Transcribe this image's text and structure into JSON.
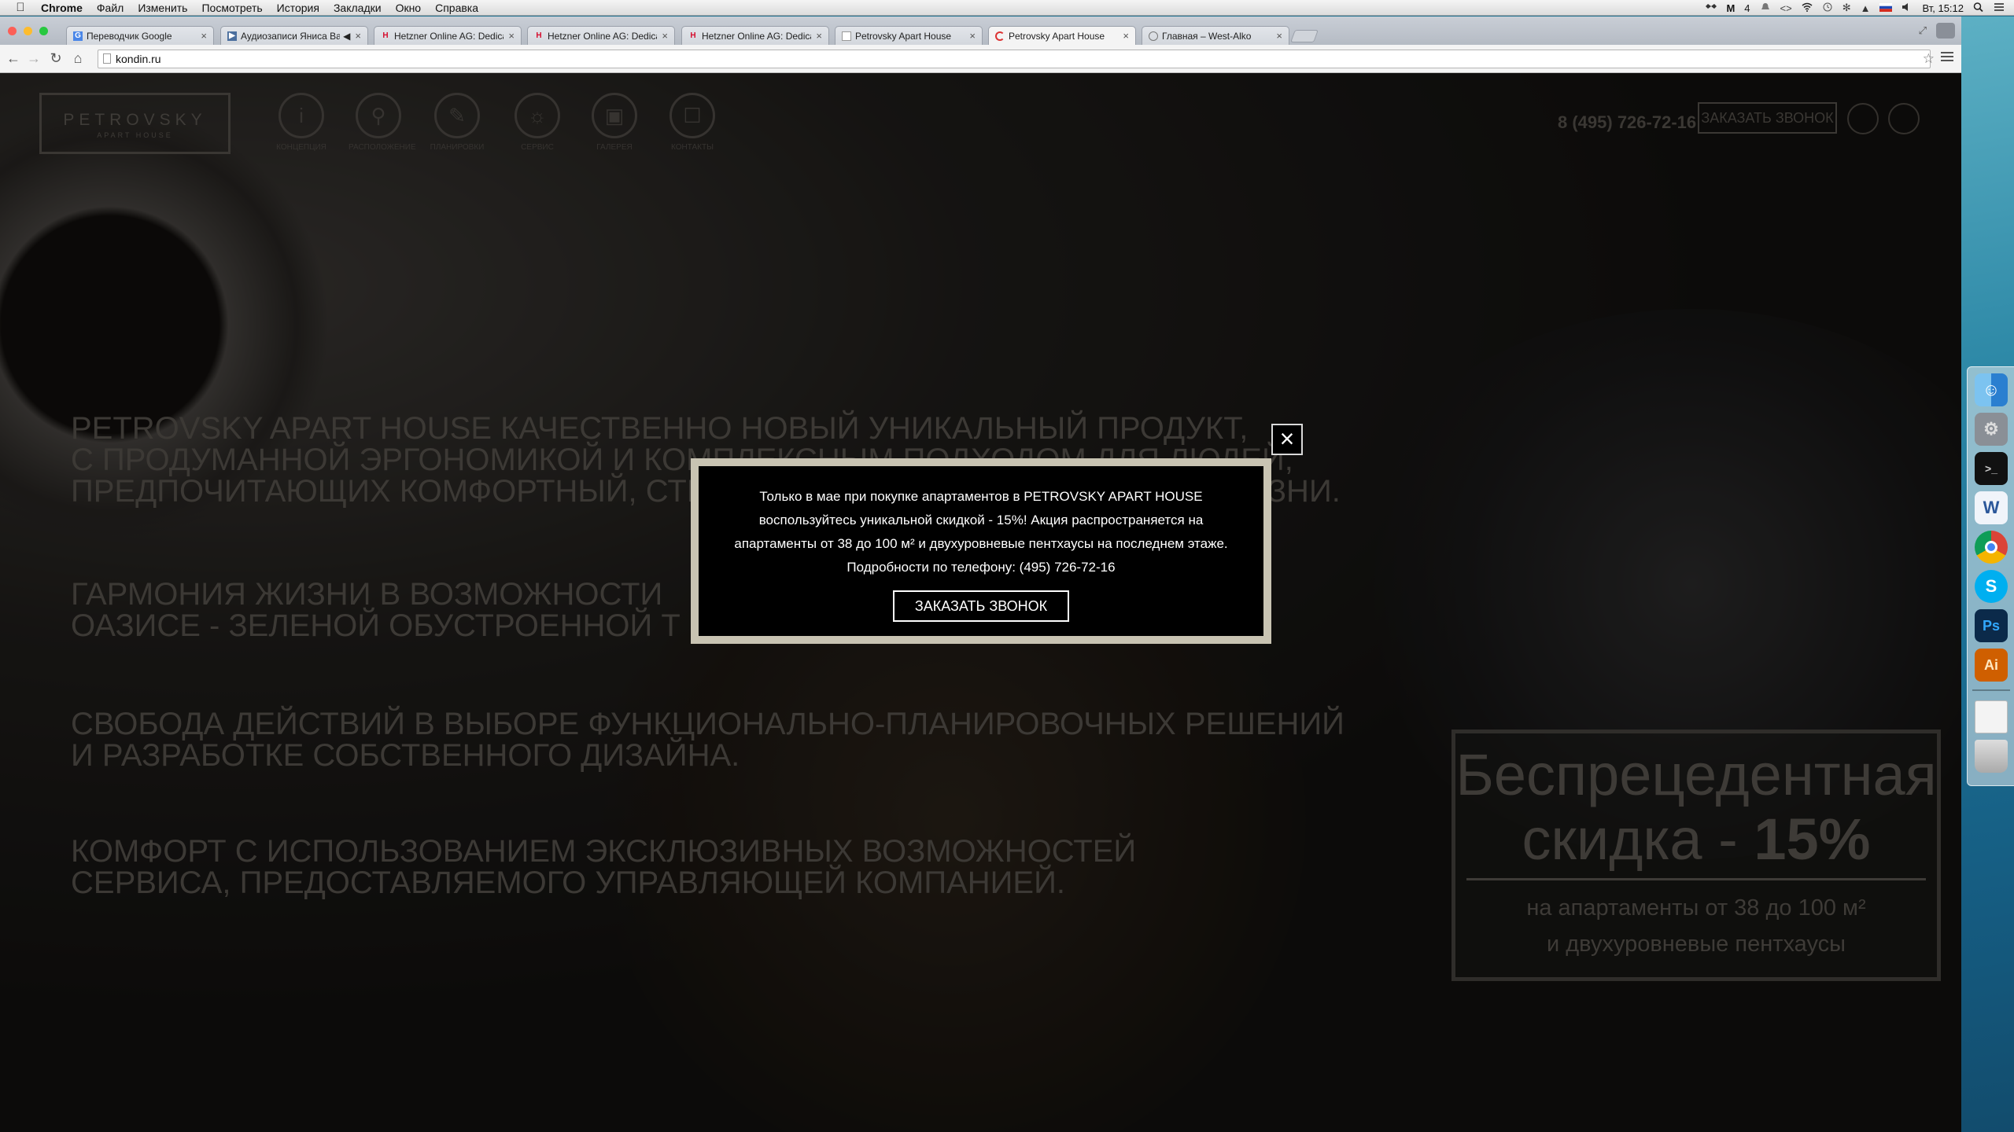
{
  "menubar": {
    "app": "Chrome",
    "items": [
      "Файл",
      "Изменить",
      "Посмотреть",
      "История",
      "Закладки",
      "Окно",
      "Справка"
    ],
    "status": {
      "count": "4",
      "clock": "Вт, 15:12"
    }
  },
  "browser": {
    "tabs": [
      {
        "label": "Переводчик Google"
      },
      {
        "label": "Аудиозаписи Яниса Ва"
      },
      {
        "label": "Hetzner Online AG: Dedica"
      },
      {
        "label": "Hetzner Online AG: Dedica"
      },
      {
        "label": "Hetzner Online AG: Dedica"
      },
      {
        "label": "Petrovsky Apart House"
      },
      {
        "label": "Petrovsky Apart House"
      },
      {
        "label": "Главная – West-Alko"
      }
    ],
    "url": "kondin.ru"
  },
  "site": {
    "logo": {
      "line1": "PETROVSKY",
      "line2": "APART HOUSE"
    },
    "nav": [
      {
        "label": "КОНЦЕПЦИЯ",
        "icon": "info-icon"
      },
      {
        "label": "РАСПОЛОЖЕНИЕ",
        "icon": "location-icon"
      },
      {
        "label": "ПЛАНИРОВКИ",
        "icon": "plan-icon"
      },
      {
        "label": "СЕРВИС",
        "icon": "lightbulb-icon"
      },
      {
        "label": "ГАЛЕРЕЯ",
        "icon": "gallery-icon"
      },
      {
        "label": "КОНТАКТЫ",
        "icon": "contacts-icon"
      }
    ],
    "phone": "8 (495) 726-72-16",
    "call_button": "ЗАКАЗАТЬ ЗВОНОК",
    "slogans": [
      "PETROVSKY APART HOUSE КАЧЕСТВЕННО НОВЫЙ УНИКАЛЬНЫЙ ПРОДУКТ,\nС ПРОДУМАННОЙ ЭРГОНОМИКОЙ И КОМПЛЕКСНЫМ ПОДХОДОМ ДЛЯ ЛЮДЕЙ,\nПРЕДПОЧИТАЮЩИХ КОМФОРТНЫЙ, СТИЛЬНЫЙ И ДИНАМИЧНЫЙ ОБРАЗ ЖИЗНИ.",
      "ГАРМОНИЯ ЖИЗНИ В ВОЗМОЖНОСТИ\nОАЗИСЕ - ЗЕЛЕНОЙ ОБУСТРОЕННОЙ Т",
      "СВОБОДА ДЕЙСТВИЙ В ВЫБОРЕ ФУНКЦИОНАЛЬНО-ПЛАНИРОВОЧНЫХ РЕШЕНИЙ\nИ РАЗРАБОТКЕ СОБСТВЕННОГО ДИЗАЙНА.",
      "КОМФОРТ С ИСПОЛЬЗОВАНИЕМ ЭКСКЛЮЗИВНЫХ ВОЗМОЖНОСТЕЙ\nСЕРВИСА, ПРЕДОСТАВЛЯЕМОГО УПРАВЛЯЮЩЕЙ КОМПАНИЕЙ."
    ],
    "promo": {
      "line1": "Беспрецедентная",
      "line2_prefix": "скидка - ",
      "line2_value": "15%",
      "line3": "на апартаменты от 38 до 100 м²",
      "line4": "и двухуровневые пентхаусы"
    }
  },
  "modal": {
    "lines": [
      "Только в мае при покупке апартаментов в PETROVSKY APART HOUSE",
      "воспользуйтесь уникальной скидкой - 15%! Акция распространяется на",
      "апартаменты от 38 до 100 м² и двухуровневые пентхаусы на последнем этаже.",
      "Подробности по телефону: (495) 726-72-16"
    ],
    "button": "ЗАКАЗАТЬ ЗВОНОК",
    "close": "×"
  },
  "dock": {
    "items": [
      {
        "name": "finder-icon",
        "glyph": ""
      },
      {
        "name": "system-preferences-icon",
        "glyph": "⚙"
      },
      {
        "name": "terminal-icon",
        "glyph": ">_"
      },
      {
        "name": "word-icon",
        "glyph": "W"
      },
      {
        "name": "chrome-icon",
        "glyph": ""
      },
      {
        "name": "skype-icon",
        "glyph": "S"
      },
      {
        "name": "photoshop-icon",
        "glyph": "Ps"
      },
      {
        "name": "illustrator-icon",
        "glyph": "Ai"
      },
      {
        "name": "documents-icon",
        "glyph": ""
      },
      {
        "name": "trash-icon",
        "glyph": ""
      }
    ]
  },
  "colors": {
    "modal_frame": "#c8c3b2",
    "modal_bg": "#000000",
    "page_text_dim": "#3c3935"
  }
}
